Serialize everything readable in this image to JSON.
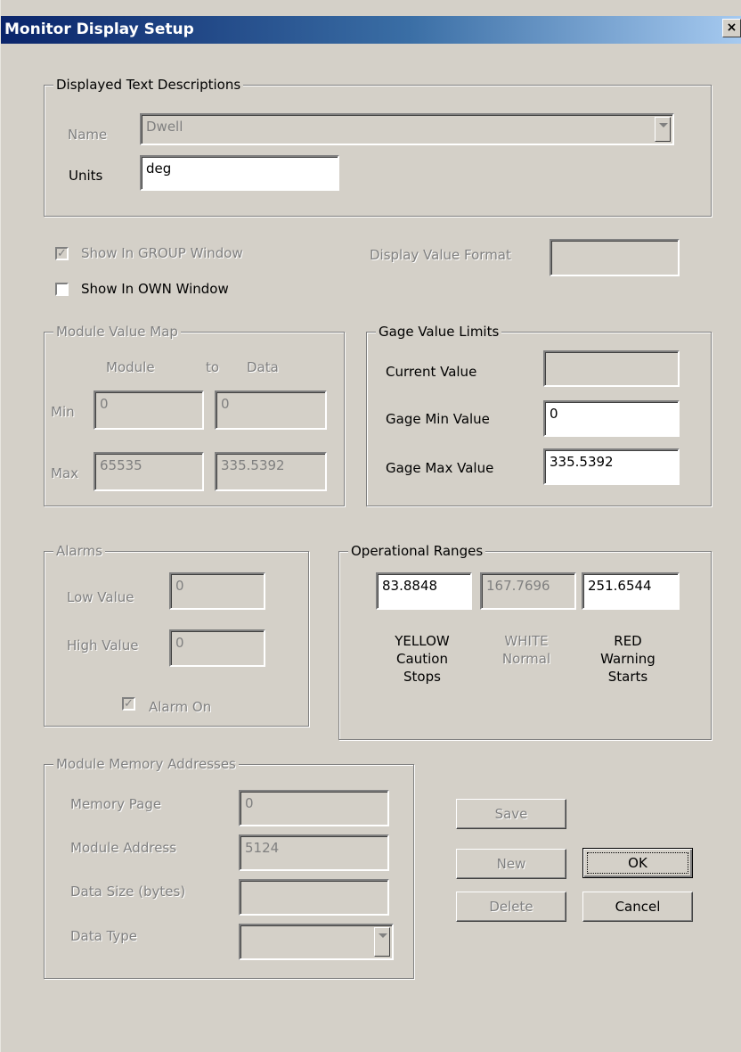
{
  "window": {
    "title": "Monitor Display Setup",
    "close_glyph": "×"
  },
  "text_desc": {
    "legend": "Displayed Text Descriptions",
    "name_label": "Name",
    "name_value": "Dwell",
    "units_label": "Units",
    "units_value": "deg"
  },
  "options": {
    "show_group_label": "Show In GROUP Window",
    "show_group_checked": true,
    "show_own_label": "Show In OWN Window",
    "show_own_checked": false,
    "display_format_label": "Display Value Format",
    "display_format_value": ""
  },
  "module_map": {
    "legend": "Module Value Map",
    "col_module": "Module",
    "col_to": "to",
    "col_data": "Data",
    "min_label": "Min",
    "max_label": "Max",
    "min_module": "0",
    "min_data": "0",
    "max_module": "65535",
    "max_data": "335.5392"
  },
  "gage": {
    "legend": "Gage Value Limits",
    "current_label": "Current Value",
    "current_value": "",
    "min_label": "Gage Min Value",
    "min_value": "0",
    "max_label": "Gage Max Value",
    "max_value": "335.5392"
  },
  "alarms": {
    "legend": "Alarms",
    "low_label": "Low Value",
    "low_value": "0",
    "high_label": "High Value",
    "high_value": "0",
    "alarm_on_label": "Alarm On",
    "alarm_on_checked": true
  },
  "ranges": {
    "legend": "Operational Ranges",
    "yellow_value": "83.8848",
    "white_value": "167.7696",
    "red_value": "251.6544",
    "yellow_caption": "YELLOW Caution Stops",
    "white_caption": "WHITE Normal",
    "red_caption": "RED Warning Starts"
  },
  "memory": {
    "legend": "Module Memory Addresses",
    "page_label": "Memory Page",
    "page_value": "0",
    "address_label": "Module Address",
    "address_value": "5124",
    "size_label": "Data Size (bytes)",
    "size_value": "",
    "type_label": "Data Type",
    "type_value": ""
  },
  "buttons": {
    "save": "Save",
    "new": "New",
    "delete": "Delete",
    "ok": "OK",
    "cancel": "Cancel"
  },
  "icons": {
    "checkbox_check": "✓",
    "dropdown_arrow": "chevron-down-icon"
  }
}
